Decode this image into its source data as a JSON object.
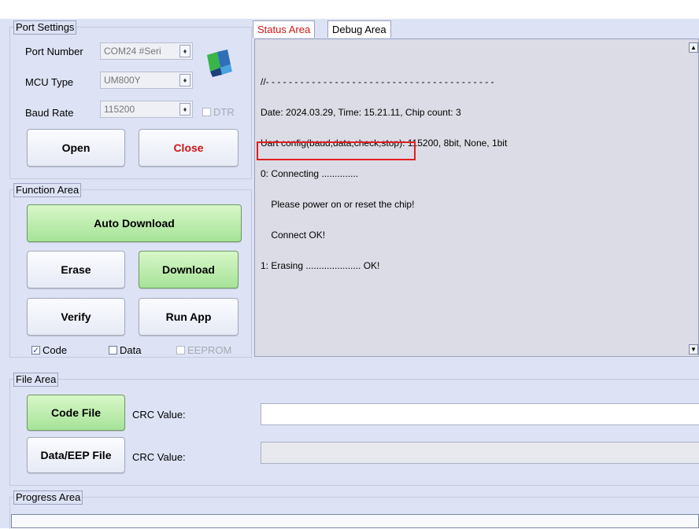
{
  "port_settings": {
    "legend": "Port Settings",
    "port_number_label": "Port Number",
    "port_number_value": "COM24 #Seri",
    "mcu_type_label": "MCU Type",
    "mcu_type_value": "UM800Y",
    "baud_rate_label": "Baud Rate",
    "baud_rate_value": "115200",
    "dtr_label": "DTR",
    "open_label": "Open",
    "close_label": "Close"
  },
  "function_area": {
    "legend": "Function Area",
    "auto_download_label": "Auto Download",
    "erase_label": "Erase",
    "download_label": "Download",
    "verify_label": "Verify",
    "run_app_label": "Run App",
    "code_label": "Code",
    "data_label": "Data",
    "eeprom_label": "EEPROM"
  },
  "tabs": {
    "status_area": "Status Area",
    "debug_area": "Debug Area"
  },
  "log": {
    "line1": "//- - - - - - - - - - - - - - - - - - - - - - - - - - - - - - - - - - - - - - - -",
    "line2": "Date: 2024.03.29, Time: 15.21.11, Chip count: 3",
    "line3": "Uart config(baud,data,check,stop): 115200, 8bit, None, 1bit",
    "line4": "0: Connecting ..............",
    "line5": "    Please power on or reset the chip!",
    "line6": "    Connect OK!",
    "line7": "1: Erasing ..................... OK!"
  },
  "file_area": {
    "legend": "File Area",
    "code_file_label": "Code File",
    "crc_label_1": "CRC Value:",
    "data_eep_file_label": "Data/EEP File",
    "crc_label_2": "CRC Value:"
  },
  "progress_area": {
    "legend": "Progress Area"
  },
  "icons": {
    "app_logo": "logo-icon",
    "scroll_up": "scroll-up-icon",
    "scroll_down": "scroll-down-icon"
  }
}
